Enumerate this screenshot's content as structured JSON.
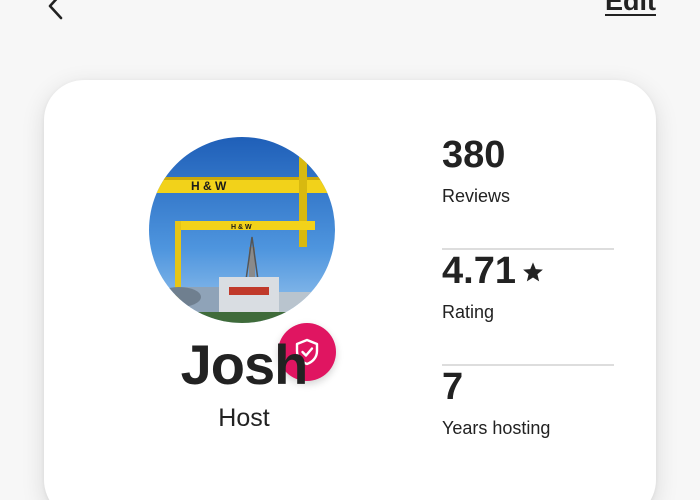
{
  "topbar": {
    "back_icon": "chevron-left-icon",
    "edit_label": "Edit"
  },
  "profile": {
    "name": "Josh",
    "role": "Host",
    "verified_icon": "shield-check-icon",
    "badge_color": "#e01561"
  },
  "stats": [
    {
      "value": "380",
      "label": "Reviews"
    },
    {
      "value": "4.71",
      "label": "Rating",
      "icon": "star-icon"
    },
    {
      "value": "7",
      "label": "Years hosting"
    }
  ],
  "avatar": {
    "crane_text_1": "H & W",
    "crane_text_2": "H & W"
  }
}
